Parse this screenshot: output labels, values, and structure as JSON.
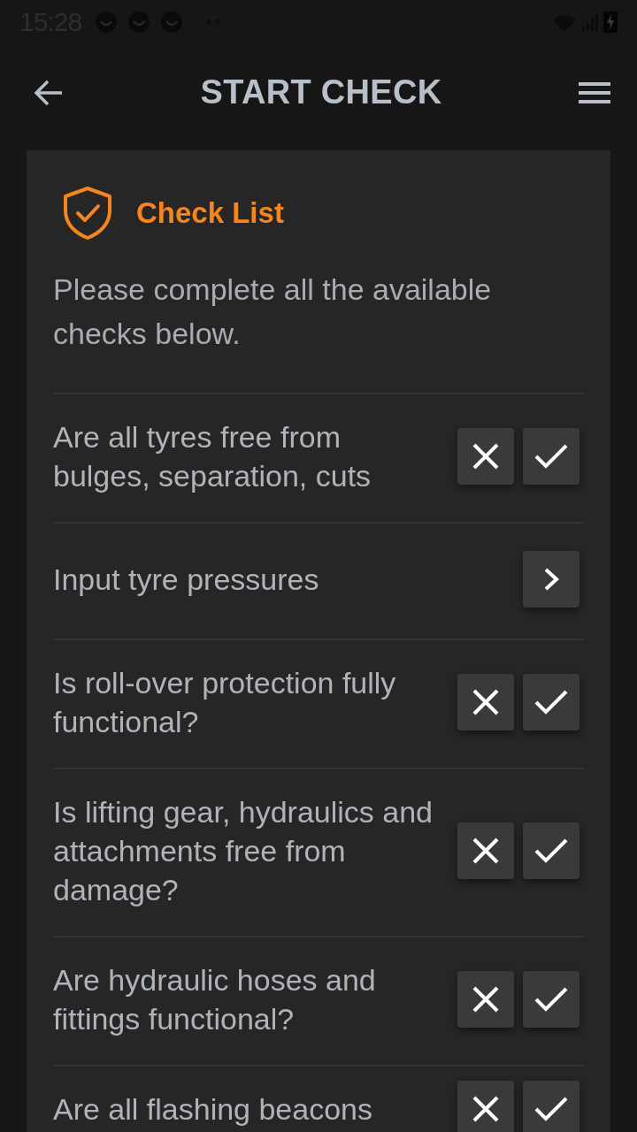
{
  "status_bar": {
    "time": "15:28"
  },
  "app_bar": {
    "title": "START CHECK"
  },
  "card": {
    "title": "Check List",
    "intro": "Please complete all the available checks below."
  },
  "checks": [
    {
      "kind": "yes_no",
      "question": "Are all tyres free from bulges, separation, cuts"
    },
    {
      "kind": "open",
      "question": "Input tyre pressures"
    },
    {
      "kind": "yes_no",
      "question": "Is roll-over protection fully functional?"
    },
    {
      "kind": "yes_no",
      "question": "Is lifting gear, hydraulics and attachments free from damage?"
    },
    {
      "kind": "yes_no",
      "question": "Are hydraulic hoses and fittings functional?"
    },
    {
      "kind": "yes_no",
      "question": "Are all flashing beacons"
    }
  ]
}
